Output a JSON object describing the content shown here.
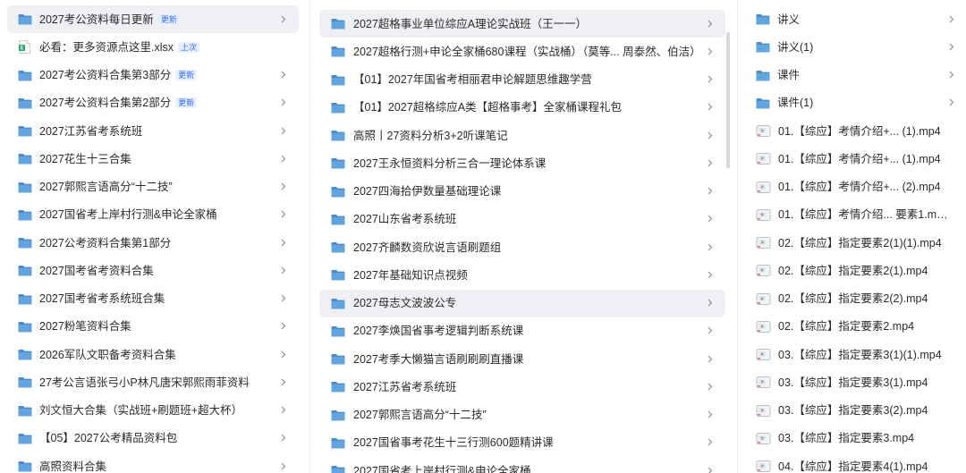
{
  "col1": [
    {
      "type": "folder",
      "name": "2027考公资料每日更新",
      "badge": "更新",
      "selected": true
    },
    {
      "type": "xlsx",
      "name": "必看：更多资源点这里.xlsx",
      "badge": "上次"
    },
    {
      "type": "folder",
      "name": "2027考公资料合集第3部分",
      "badge": "更新"
    },
    {
      "type": "folder",
      "name": "2027考公资料合集第2部分",
      "badge": "更新"
    },
    {
      "type": "folder",
      "name": "2027江苏省考系统班"
    },
    {
      "type": "folder",
      "name": "2027花生十三合集"
    },
    {
      "type": "folder",
      "name": "2027郭熙言语高分“十二技”"
    },
    {
      "type": "folder",
      "name": "2027国省考上岸村行测&申论全家桶"
    },
    {
      "type": "folder",
      "name": "2027公考资料合集第1部分"
    },
    {
      "type": "folder",
      "name": "2027国考省考资料合集"
    },
    {
      "type": "folder",
      "name": "2027国考省考系统班合集"
    },
    {
      "type": "folder",
      "name": "2027粉笔资料合集"
    },
    {
      "type": "folder",
      "name": "2026军队文职备考资料合集"
    },
    {
      "type": "folder",
      "name": "27考公言语张弓小P林凡唐宋郭熙雨菲资料"
    },
    {
      "type": "folder",
      "name": "刘文恒大合集（实战班+刷题班+超大杯）"
    },
    {
      "type": "folder",
      "name": "【05】2027公考精品资料包"
    },
    {
      "type": "folder",
      "name": "高照资料合集"
    }
  ],
  "col2": [
    {
      "type": "folder",
      "name": "2027超格事业单位综应A理论实战班（王一一）",
      "selected": true
    },
    {
      "type": "folder",
      "name": "2027超格行测+申论全家桶680课程（实战桶）（莫等... 周泰然、伯洁）"
    },
    {
      "type": "folder",
      "name": "【01】2027年国省考相丽君申论解题思维趣学营"
    },
    {
      "type": "folder",
      "name": "【01】2027超格综应A类【超格事考】全家桶课程礼包"
    },
    {
      "type": "folder",
      "name": "高照丨27资料分析3+2听课笔记"
    },
    {
      "type": "folder",
      "name": "2027王永恒资料分析三合一理论体系课"
    },
    {
      "type": "folder",
      "name": "2027四海拾伊数量基础理论课"
    },
    {
      "type": "folder",
      "name": "2027山东省考系统班"
    },
    {
      "type": "folder",
      "name": "2027齐麟数资欣说言语刷题组"
    },
    {
      "type": "folder",
      "name": "2027年基础知识点视频"
    },
    {
      "type": "folder",
      "name": "2027母志文波波公专",
      "selected": true
    },
    {
      "type": "folder",
      "name": "2027李焕国省事考逻辑判断系统课"
    },
    {
      "type": "folder",
      "name": "2027考季大懒猫言语刷刷刷直播课"
    },
    {
      "type": "folder",
      "name": "2027江苏省考系统班"
    },
    {
      "type": "folder",
      "name": "2027郭熙言语高分“十二技”"
    },
    {
      "type": "folder",
      "name": "2027国省事考花生十三行测600题精讲课"
    },
    {
      "type": "folder",
      "name": "2027国省考上岸村行测&申论全家桶"
    }
  ],
  "col3": [
    {
      "type": "folder",
      "name": "讲义"
    },
    {
      "type": "folder",
      "name": "讲义(1)"
    },
    {
      "type": "folder",
      "name": "课件"
    },
    {
      "type": "folder",
      "name": "课件(1)"
    },
    {
      "type": "video",
      "name": "01.【综应】考情介绍+...  (1).mp4"
    },
    {
      "type": "video",
      "name": "01.【综应】考情介绍+...  (1).mp4"
    },
    {
      "type": "video",
      "name": "01.【综应】考情介绍+...  (2).mp4"
    },
    {
      "type": "video",
      "name": "01.【综应】考情介绍... 要素1.mp4"
    },
    {
      "type": "video",
      "name": "02.【综应】指定要素2(1)(1).mp4"
    },
    {
      "type": "video",
      "name": "02.【综应】指定要素2(1).mp4"
    },
    {
      "type": "video",
      "name": "02.【综应】指定要素2(2).mp4"
    },
    {
      "type": "video",
      "name": "02.【综应】指定要素2.mp4"
    },
    {
      "type": "video",
      "name": "03.【综应】指定要素3(1)(1).mp4"
    },
    {
      "type": "video",
      "name": "03.【综应】指定要素3(1).mp4"
    },
    {
      "type": "video",
      "name": "03.【综应】指定要素3(2).mp4"
    },
    {
      "type": "video",
      "name": "03.【综应】指定要素3.mp4"
    },
    {
      "type": "video",
      "name": "04.【综应】指定要素4(1).mp4"
    }
  ],
  "colors": {
    "folder": "#5a9bd5",
    "folder_tab": "#4b8ccc",
    "selected_bg": "#eef0f4",
    "badge_text": "#2f6bff",
    "excel": "#21a366"
  }
}
